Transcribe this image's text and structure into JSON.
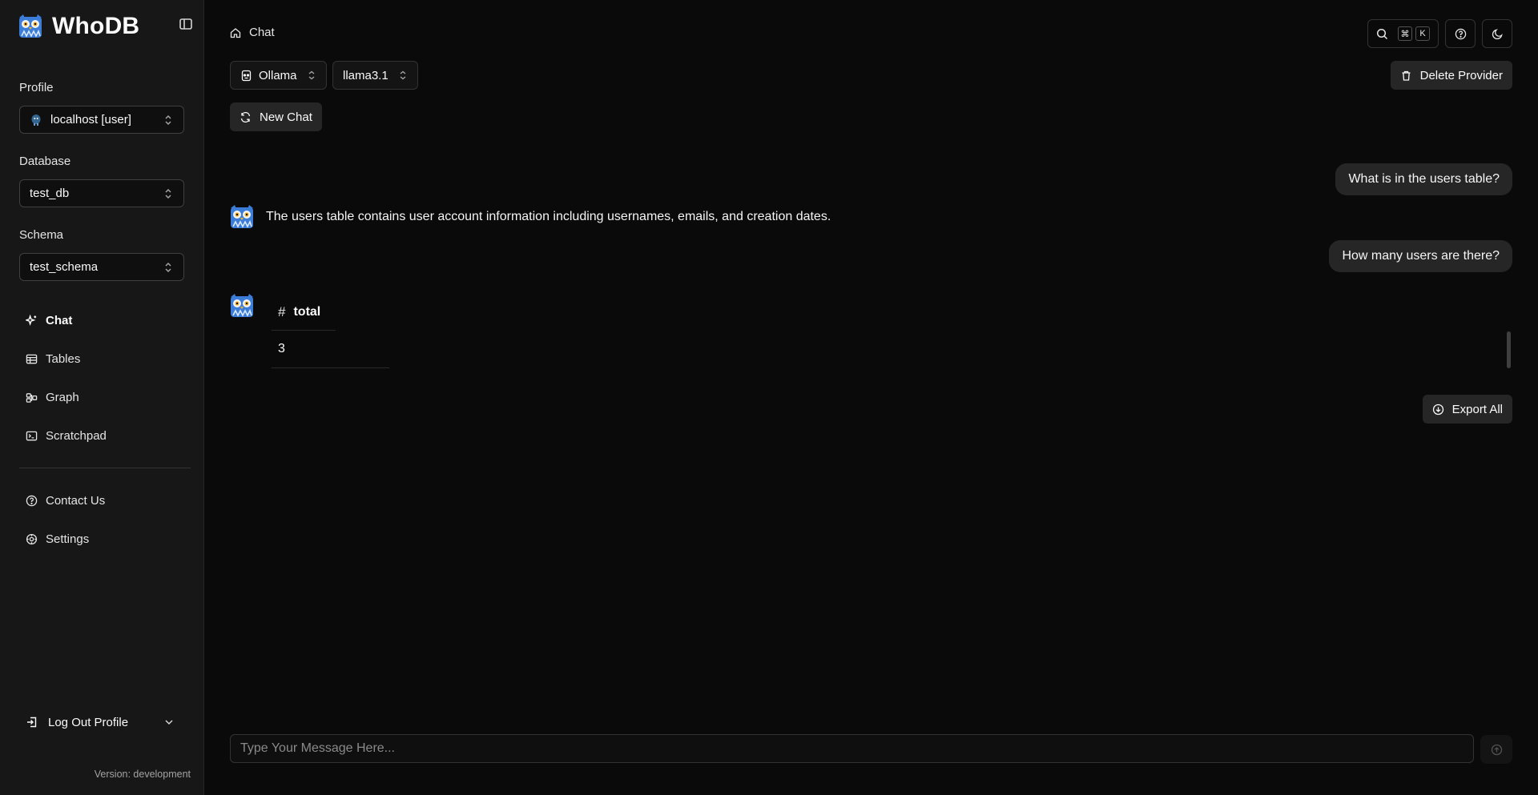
{
  "app": {
    "title": "WhoDB"
  },
  "sidebar": {
    "profile": {
      "label": "Profile",
      "value": "localhost [user]"
    },
    "database": {
      "label": "Database",
      "value": "test_db"
    },
    "schema": {
      "label": "Schema",
      "value": "test_schema"
    },
    "nav": [
      {
        "label": "Chat",
        "icon": "sparkles-icon",
        "active": true
      },
      {
        "label": "Tables",
        "icon": "table-icon"
      },
      {
        "label": "Graph",
        "icon": "graph-icon"
      },
      {
        "label": "Scratchpad",
        "icon": "terminal-icon"
      }
    ],
    "secondary": [
      {
        "label": "Contact Us",
        "icon": "help-circle-icon"
      },
      {
        "label": "Settings",
        "icon": "gear-icon"
      }
    ],
    "logout_label": "Log Out Profile",
    "version": "Version: development"
  },
  "header": {
    "breadcrumb": "Chat",
    "shortcut_keys": [
      "⌘",
      "K"
    ]
  },
  "toolbar": {
    "provider": "Ollama",
    "model": "llama3.1",
    "new_chat": "New Chat",
    "delete_provider": "Delete Provider"
  },
  "chat": {
    "messages": [
      {
        "role": "user",
        "text": "What is in the users table?"
      },
      {
        "role": "assistant",
        "text": "The users table contains user account information including usernames, emails, and creation dates."
      },
      {
        "role": "user",
        "text": "How many users are there?"
      },
      {
        "role": "assistant",
        "table": {
          "columns": [
            "total"
          ],
          "rows": [
            [
              "3"
            ]
          ]
        }
      }
    ],
    "table_hash": "#",
    "export_all": "Export All",
    "input_placeholder": "Type Your Message Here..."
  },
  "colors": {
    "background": "#0a0a0a",
    "sidebar": "#171717",
    "bubble": "#262626",
    "owl_blue": "#3b7dd8"
  }
}
